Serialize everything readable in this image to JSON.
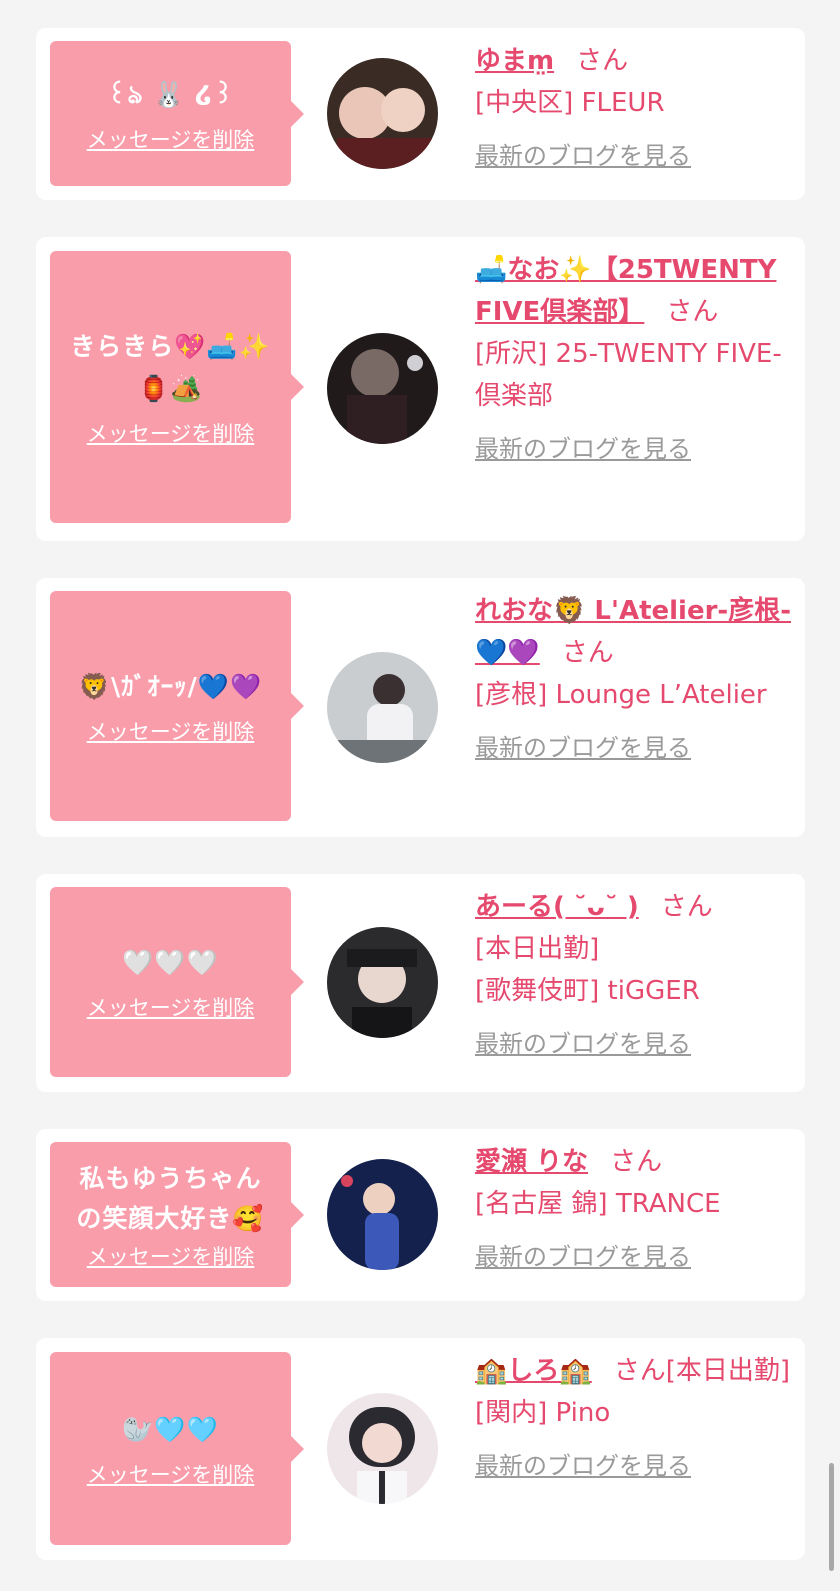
{
  "messages": [
    {
      "bubble": "꒰ঌ 🐰 ໒꒱",
      "delete_label": "メッセージを削除",
      "name": "ゆまm̤",
      "honorific": "さん",
      "meta_lines": [
        "[中央区] FLEUR"
      ],
      "blog_label": "最新のブログを見る",
      "avatar_colors": [
        "#3a2b25",
        "#e9c6b8"
      ]
    },
    {
      "bubble": "きらきら💖🛋️✨🏮🏕️",
      "delete_label": "メッセージを削除",
      "name": "🛋️なお✨【25TWENTY FIVE倶楽部】",
      "honorific": "さん",
      "meta_lines": [
        "[所沢] 25-TWENTY FIVE-倶楽部"
      ],
      "blog_label": "最新のブログを見る",
      "avatar_colors": [
        "#201a1a",
        "#7a6a66"
      ]
    },
    {
      "bubble": "🦁\\ｶﾞｵｰｯ/💙💜",
      "delete_label": "メッセージを削除",
      "name": "れおな🦁 L'Atelier-彦根-💙💜",
      "honorific": "さん",
      "meta_lines": [
        "[彦根] Lounge L’Atelier"
      ],
      "blog_label": "最新のブログを見る",
      "avatar_colors": [
        "#c9cdd0",
        "#6e7378"
      ]
    },
    {
      "bubble": "🤍🤍🤍",
      "delete_label": "メッセージを削除",
      "name": "あーる( ˘ᴗ˘ )",
      "honorific": "さん",
      "meta_lines": [
        "[本日出勤]",
        "[歌舞伎町] tiGGER"
      ],
      "blog_label": "最新のブログを見る",
      "avatar_colors": [
        "#2b2b2e",
        "#e7d7cf"
      ]
    },
    {
      "bubble": "私もゆうちゃんの笑顔大好き🥰",
      "delete_label": "メッセージを削除",
      "name": "愛瀬 りな",
      "honorific": "さん",
      "meta_lines": [
        "[名古屋 錦] TRANCE"
      ],
      "blog_label": "最新のブログを見る",
      "avatar_colors": [
        "#14214d",
        "#3c58b8"
      ]
    },
    {
      "bubble": "🦭🩵🩵",
      "delete_label": "メッセージを削除",
      "name": "🏫しろ🏫",
      "honorific": "さん[本日出勤]",
      "meta_lines": [
        "[関内] Pino"
      ],
      "blog_label": "最新のブログを見る",
      "avatar_colors": [
        "#2a2a30",
        "#efe6e9"
      ]
    }
  ],
  "colors": {
    "accent": "#e5496e",
    "bubble": "#f99dab",
    "link_gray": "#9a9a9a",
    "background": "#f4f4f5"
  }
}
